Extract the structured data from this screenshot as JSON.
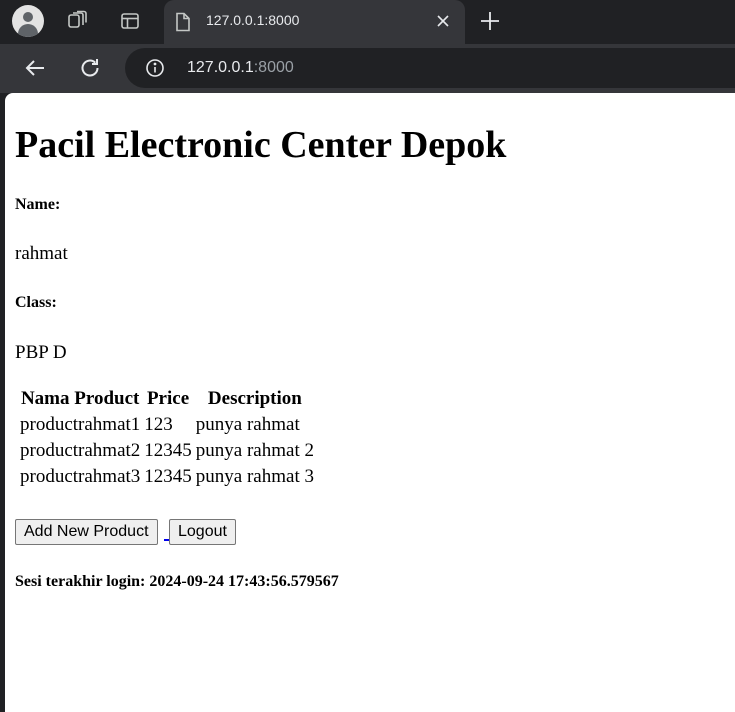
{
  "browser": {
    "tab_title": "127.0.0.1:8000",
    "url_host": "127.0.0.1",
    "url_port": ":8000"
  },
  "page": {
    "heading": "Pacil Electronic Center Depok",
    "name_label": "Name:",
    "name_value": "rahmat",
    "class_label": "Class:",
    "class_value": "PBP D",
    "table": {
      "headers": [
        "Nama Product",
        "Price",
        "Description"
      ],
      "rows": [
        [
          "productrahmat1",
          "123",
          "punya rahmat"
        ],
        [
          "productrahmat2",
          "12345",
          "punya rahmat 2"
        ],
        [
          "productrahmat3",
          "12345",
          "punya rahmat 3"
        ]
      ]
    },
    "add_button": "Add New Product",
    "logout_button": "Logout",
    "session_text": "Sesi terakhir login: 2024-09-24 17:43:56.579567"
  }
}
